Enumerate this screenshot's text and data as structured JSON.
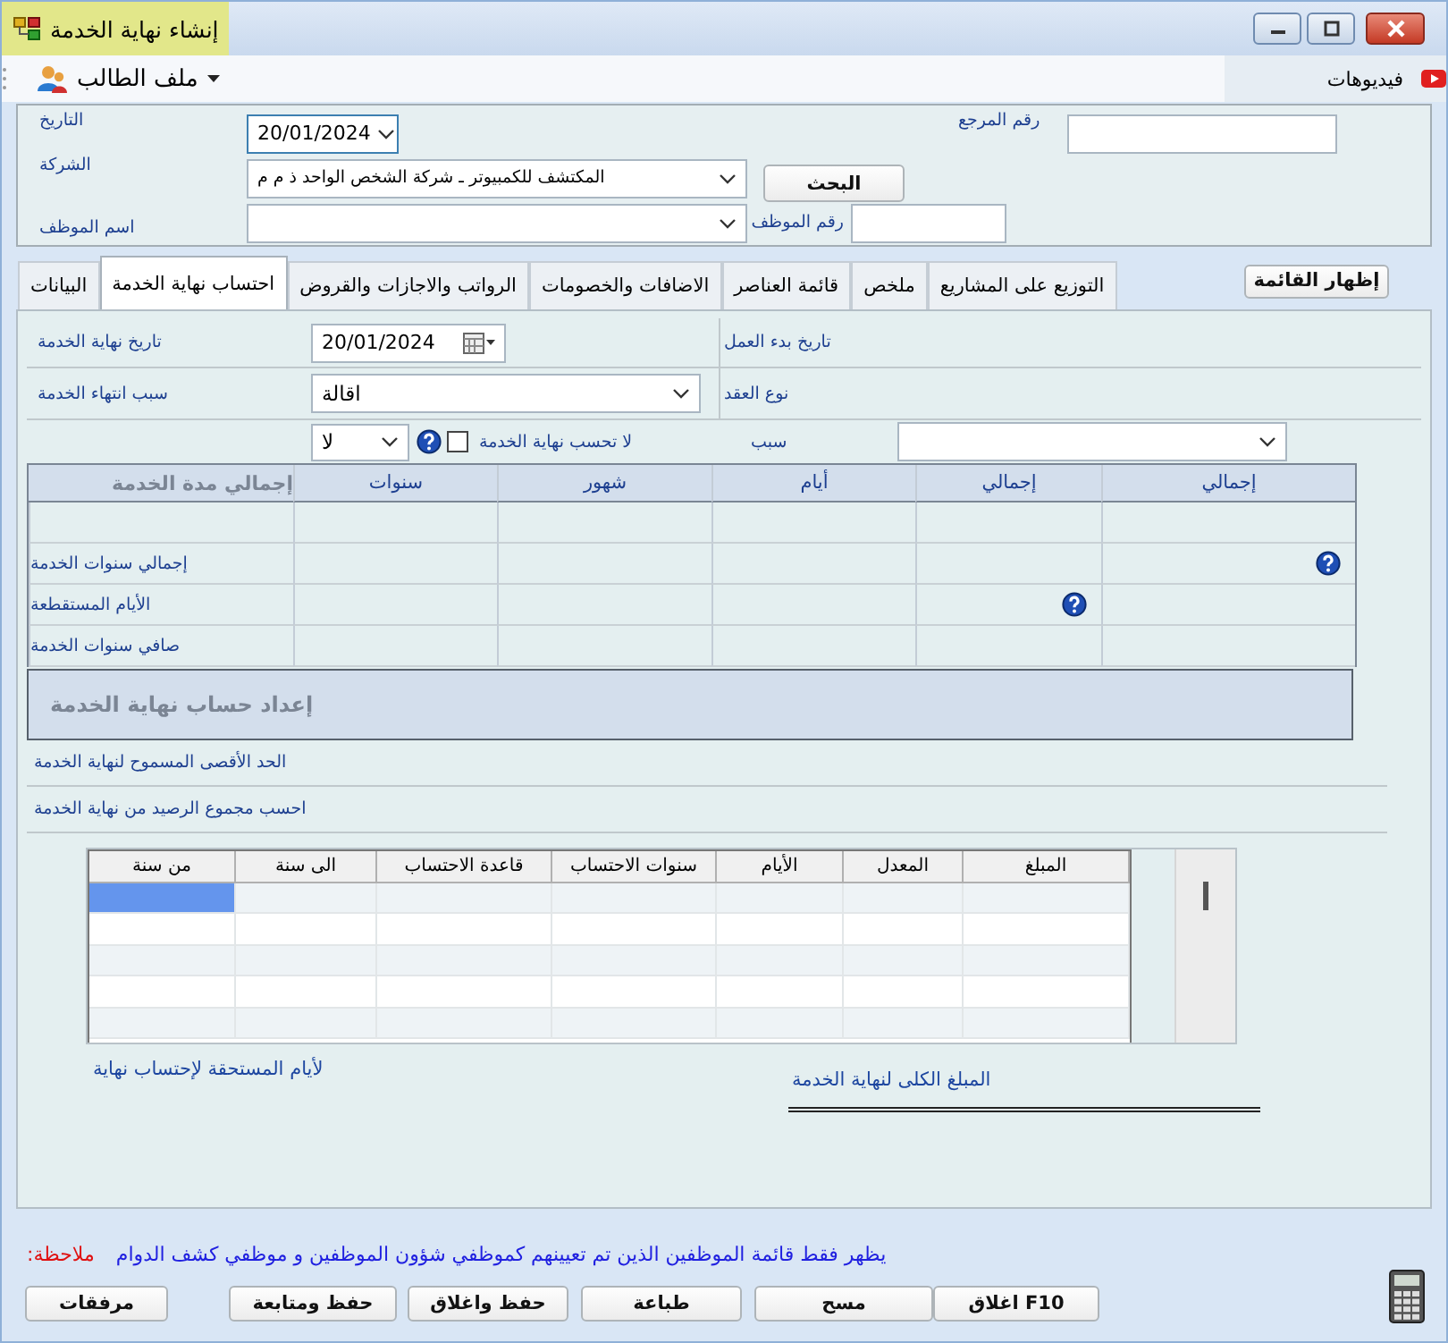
{
  "window": {
    "title": "إنشاء نهاية الخدمة"
  },
  "toolbar": {
    "menu": "ملف الطالب",
    "videos": "فيديوهات"
  },
  "header": {
    "date_label": "التاريخ",
    "date_value": "20/01/2024",
    "reference_label": "رقم المرجع",
    "company_label": "الشركة",
    "company_value": "المكتشف للكمبيوتر ـ شركة الشخص الواحد ذ م م",
    "search_button": "البحث",
    "employee_name_label": "اسم الموظف",
    "employee_number_label": "رقم الموظف"
  },
  "tabs": [
    {
      "label": "التوزيع على المشاريع",
      "selected": false
    },
    {
      "label": "ملخص",
      "selected": false
    },
    {
      "label": "قائمة العناصر",
      "selected": false
    },
    {
      "label": "الاضافات والخصومات",
      "selected": false
    },
    {
      "label": "الرواتب والاجازات والقروض",
      "selected": false
    },
    {
      "label": "احتساب نهاية الخدمة",
      "selected": true
    },
    {
      "label": "البيانات",
      "selected": false
    }
  ],
  "show_list_button": "إظهار القائمة",
  "service": {
    "end_date_label": "تاريخ نهاية الخدمة",
    "end_date_value": "20/01/2024",
    "start_date_label": "تاريخ بدء العمل",
    "end_reason_label": "سبب انتهاء الخدمة",
    "end_reason_value": "اقالة",
    "contract_type_label": "نوع العقد",
    "no_calc_value": "لا",
    "no_calc_checked": false,
    "no_calc_label": "لا تحسب نهاية الخدمة",
    "cause_label": "سبب"
  },
  "summary": {
    "columns": [
      "إجمالي",
      "إجمالي",
      "أيام",
      "شهور",
      "سنوات"
    ],
    "title": "إجمالي مدة الخدمة",
    "rows": [
      {
        "cells": [
          {
            "help": false
          },
          {
            "help": false
          },
          {
            "help": false
          },
          {
            "help": false
          },
          {
            "help": false
          }
        ]
      },
      {
        "cells": [
          {
            "help": true
          },
          {
            "help": false
          },
          {
            "help": false
          },
          {
            "help": false
          },
          {
            "help": false
          }
        ],
        "label": "إجمالي سنوات الخدمة"
      },
      {
        "cells": [
          {
            "help": false
          },
          {
            "help": true
          },
          {
            "help": false
          },
          {
            "help": false
          },
          {
            "help": false
          }
        ],
        "label": "الأيام المستقطعة"
      },
      {
        "cells": [
          {
            "help": false
          },
          {
            "help": false
          },
          {
            "help": false
          },
          {
            "help": false
          },
          {
            "help": false
          }
        ],
        "label": "صافي سنوات الخدمة"
      }
    ]
  },
  "setup": {
    "title": "إعداد حساب نهاية الخدمة",
    "lines": [
      "الحد الأقصى المسموح لنهاية الخدمة",
      "احسب مجموع الرصيد من نهاية الخدمة"
    ]
  },
  "grid": {
    "columns": [
      "المبلغ",
      "المعدل",
      "الأيام",
      "سنوات الاحتساب",
      "قاعدة الاحتساب",
      "الى سنة",
      "من سنة"
    ],
    "rows": [
      {
        "selected": true
      },
      {
        "selected": false
      },
      {
        "selected": false
      },
      {
        "selected": false
      },
      {
        "selected": false
      }
    ]
  },
  "totals": {
    "amount_label": "المبلغ الكلى لنهاية الخدمة",
    "days_label": "لأيام المستحقة لإحتساب نهاية"
  },
  "note": {
    "label": "ملاحظة:",
    "text": "يظهر فقط قائمة الموظفين الذين تم تعيينهم كموظفي شؤون الموظفين و موظفي كشف الدوام"
  },
  "buttons": [
    "F10 اغلاق",
    "مسح",
    "طباعة",
    "حفظ واغلاق",
    "حفظ ومتابعة",
    "مرفقات"
  ]
}
